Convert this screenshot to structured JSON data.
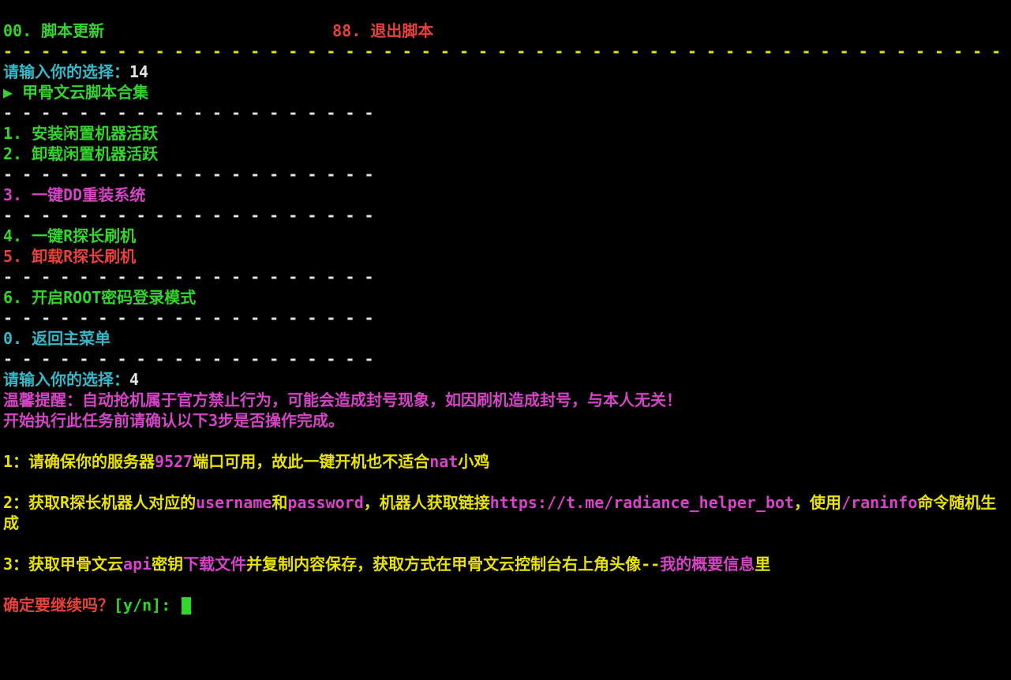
{
  "top": {
    "item00": "00. 脚本更新",
    "gap": "                        ",
    "item88": "88. 退出脚本"
  },
  "sep_long": "- - - - - - - - - - - - - - - - - - - - - - - - - - - - - - - - - - - - - - - - - - - - - - - - - - - - -",
  "sep_short": "- - - - - - - - - - - - - - - - - - - -",
  "prompt1": {
    "label": "请输入你的选择：",
    "value": "14"
  },
  "submenu_title": "▶ 甲骨文云脚本合集",
  "menu": {
    "i1": "1. 安装闲置机器活跃",
    "i2": "2. 卸载闲置机器活跃",
    "i3": "3. 一键DD重装系统",
    "i4": "4. 一键R探长刷机",
    "i5": "5. 卸载R探长刷机",
    "i6": "6. 开启ROOT密码登录模式",
    "i0": "0. 返回主菜单"
  },
  "prompt2": {
    "label": "请输入你的选择：",
    "value": "4"
  },
  "warn1": "温馨提醒：自动抢机属于官方禁止行为，可能会造成封号现象，如因刷机造成封号，与本人无关！",
  "warn2": "开始执行此任务前请确认以下3步是否操作完成。",
  "step1": {
    "pre": "1：请确保你的服务器",
    "hl1": "9527",
    "mid": "端口可用，故此一键开机也不适合",
    "hl2": "nat",
    "post": "小鸡"
  },
  "step2": {
    "pre": "2：获取R探长机器人对应的",
    "user": "username",
    "and": "和",
    "pass": "password",
    "mid": "，机器人获取链接",
    "url": "https://t.me/radiance_helper_bot",
    "post1": "，使用",
    "cmd": "/raninfo",
    "post2": "命令随机生成"
  },
  "step3": {
    "pre": "3：获取甲骨文云",
    "api": "api",
    "mid1": "密钥",
    "dl": "下载文件",
    "mid2": "并复制内容保存，获取方式在甲骨文云控制台右上角头像--",
    "info": "我的概要信息",
    "post": "里"
  },
  "confirm": {
    "label": "确定要继续吗？",
    "opts": "[y/n]: "
  }
}
